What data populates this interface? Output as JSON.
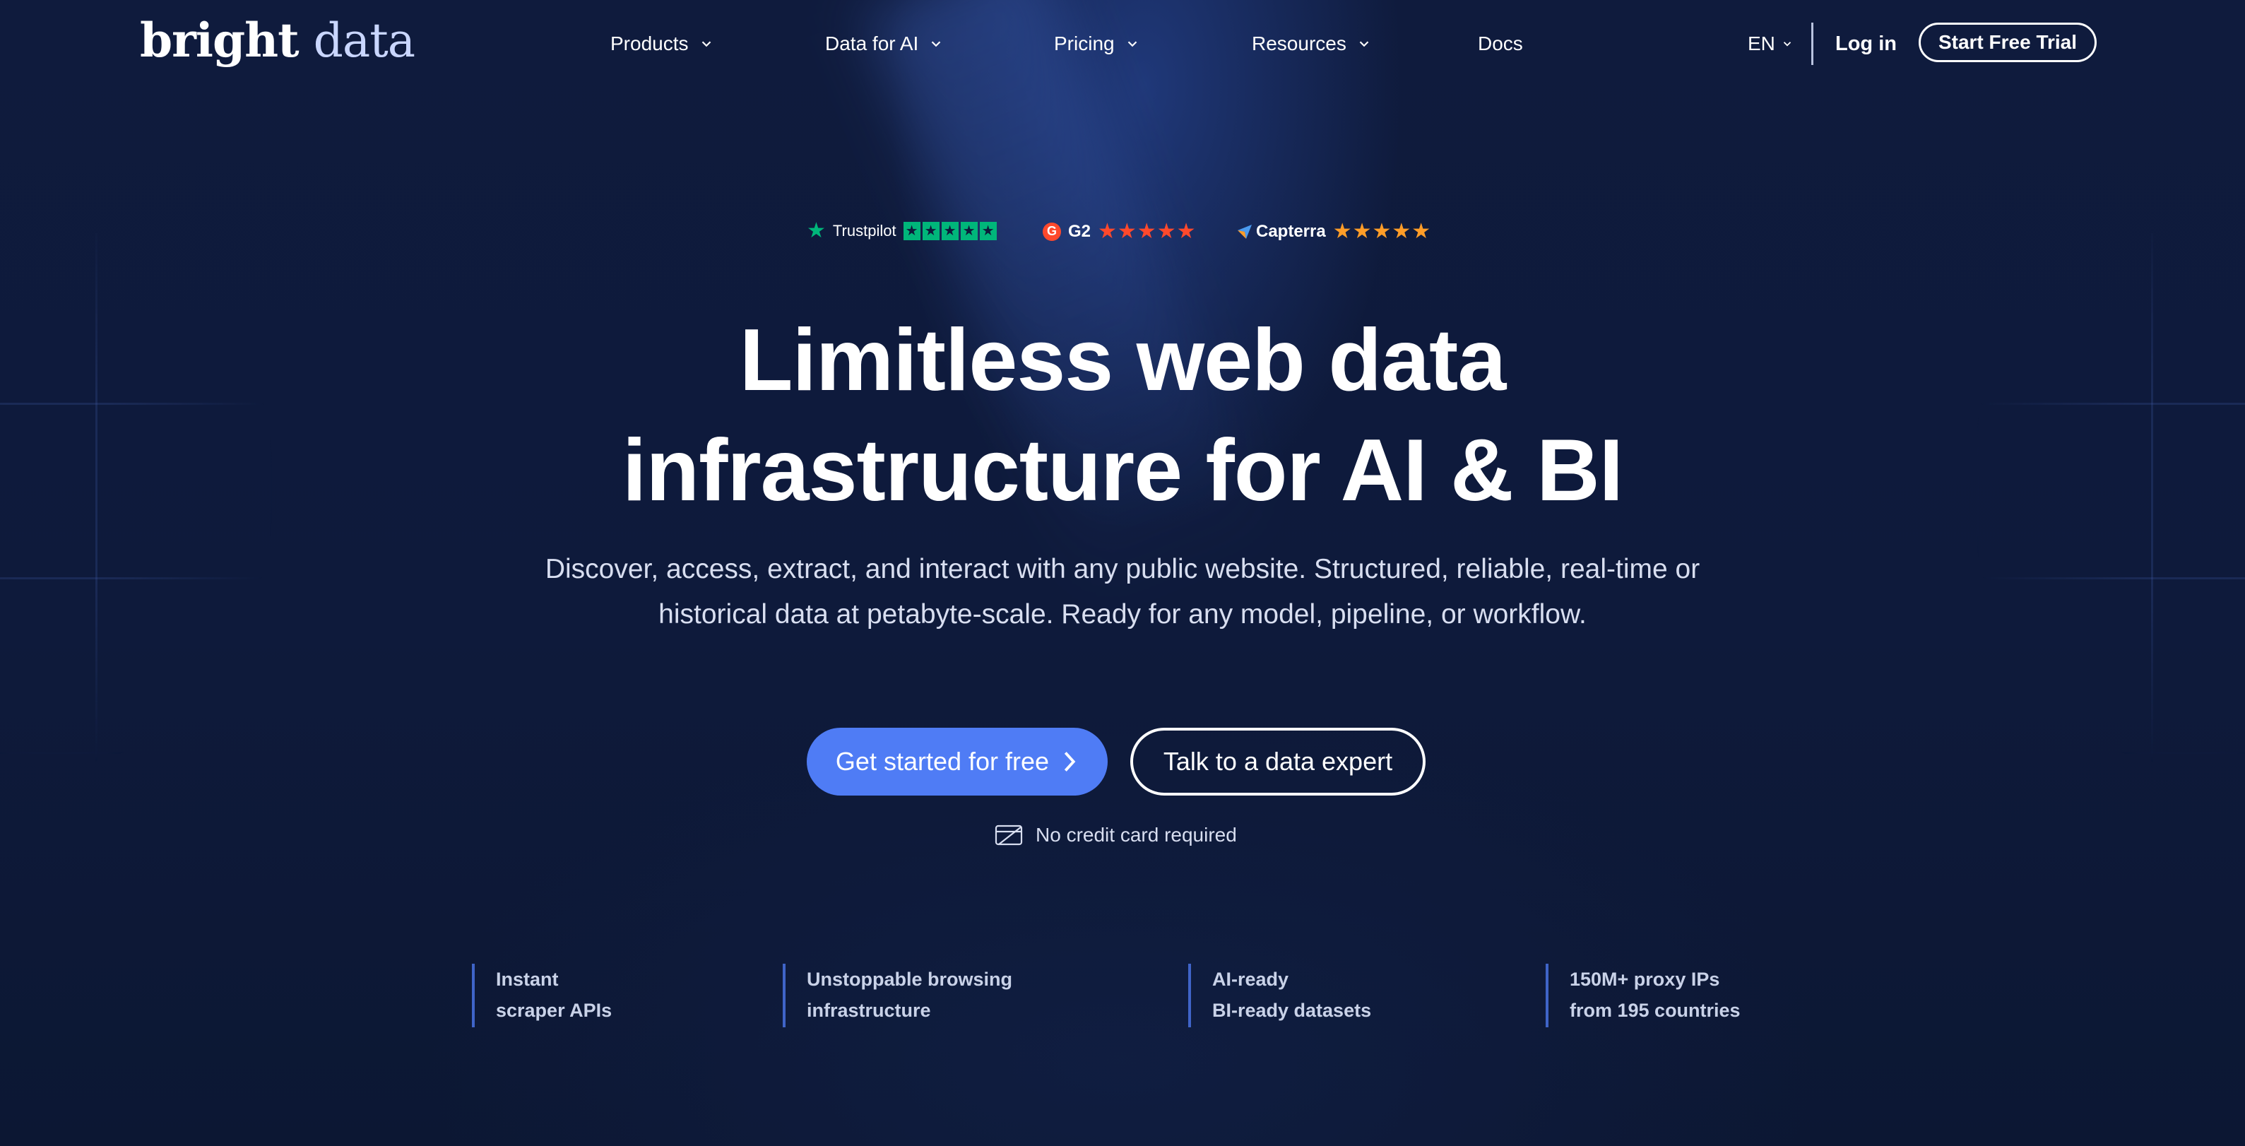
{
  "logo": {
    "bold": "bright",
    "light": "data"
  },
  "nav": {
    "items": [
      {
        "label": "Products",
        "dropdown": true
      },
      {
        "label": "Data for AI",
        "dropdown": true
      },
      {
        "label": "Pricing",
        "dropdown": true
      },
      {
        "label": "Resources",
        "dropdown": true
      },
      {
        "label": "Docs",
        "dropdown": false
      }
    ],
    "language": "EN",
    "login": "Log in",
    "trial": "Start Free Trial"
  },
  "ratings": {
    "trustpilot": {
      "name": "Trustpilot",
      "stars": 5
    },
    "g2": {
      "name": "G2",
      "stars": 4.5
    },
    "capterra": {
      "name": "Capterra",
      "stars": 5
    }
  },
  "hero": {
    "title_line1": "Limitless web data",
    "title_line2": "infrastructure for AI & BI",
    "subtitle_line1": "Discover, access, extract, and interact with any public website. Structured, reliable, real-time or",
    "subtitle_line2": "historical data at petabyte-scale. Ready for any model, pipeline, or workflow.",
    "cta_primary": "Get started for free",
    "cta_secondary": "Talk to a data expert",
    "note": "No credit card required"
  },
  "features": [
    {
      "line1": "Instant",
      "line2": "scraper APIs"
    },
    {
      "line1": "Unstoppable browsing",
      "line2": "infrastructure"
    },
    {
      "line1": "AI-ready",
      "line2": "BI-ready datasets"
    },
    {
      "line1": "150M+ proxy IPs",
      "line2": "from 195 countries"
    }
  ],
  "colors": {
    "background": "#0e1a3a",
    "primary_button": "#4f7cf5",
    "trustpilot_green": "#00b67a",
    "g2_red": "#ff492c",
    "capterra_orange": "#ff9d28"
  }
}
